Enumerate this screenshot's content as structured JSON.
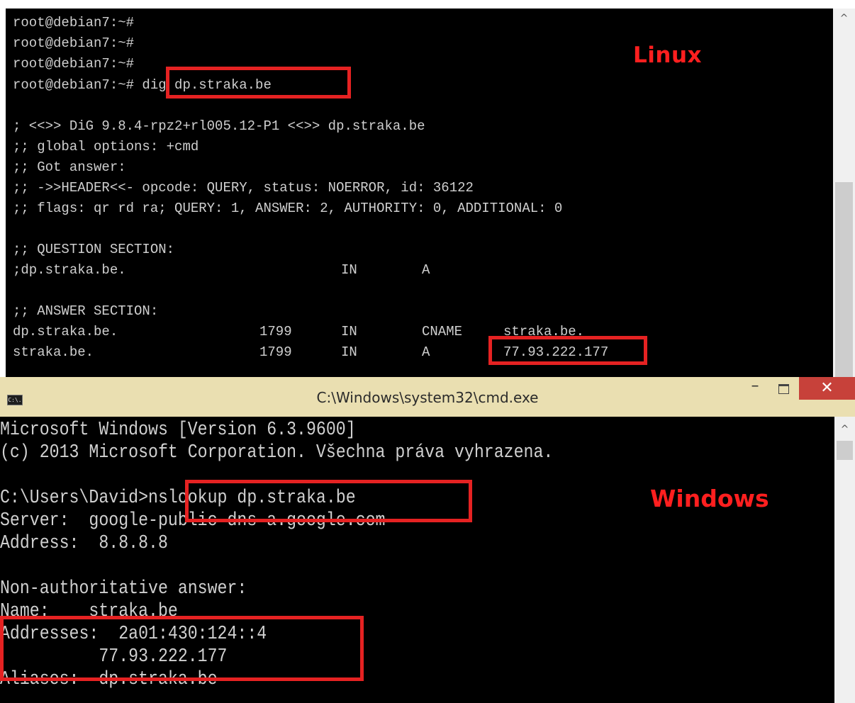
{
  "linux": {
    "label": "Linux",
    "lines": [
      {
        "text": "root@debian7:~#"
      },
      {
        "text": "root@debian7:~#"
      },
      {
        "text": "root@debian7:~#"
      },
      {
        "text": "root@debian7:~# dig dp.straka.be"
      },
      {
        "text": ""
      },
      {
        "text": "; <<>> DiG 9.8.4-rpz2+rl005.12-P1 <<>> dp.straka.be"
      },
      {
        "text": ";; global options: +cmd"
      },
      {
        "text": ";; Got answer:"
      },
      {
        "text": ";; ->>HEADER<<- opcode: QUERY, status: NOERROR, id: 36122"
      },
      {
        "text": ";; flags: qr rd ra; QUERY: 1, ANSWER: 2, AUTHORITY: 0, ADDITIONAL: 0"
      },
      {
        "text": ""
      },
      {
        "text": ";; QUESTION SECTION:"
      }
    ],
    "question": {
      "name": ";dp.straka.be.",
      "class": "IN",
      "type": "A"
    },
    "answer_header": ";; ANSWER SECTION:",
    "answers": [
      {
        "name": "dp.straka.be.",
        "ttl": "1799",
        "class": "IN",
        "type": "CNAME",
        "data": "straka.be."
      },
      {
        "name": "straka.be.",
        "ttl": "1799",
        "class": "IN",
        "type": "A",
        "data": "77.93.222.177"
      }
    ]
  },
  "windows": {
    "title": "C:\\Windows\\system32\\cmd.exe",
    "app_icon": "C:\\.",
    "minimize": "–",
    "close": "✕",
    "label": "Windows",
    "lines": [
      {
        "text": "Microsoft Windows [Version 6.3.9600]"
      },
      {
        "text": "(c) 2013 Microsoft Corporation. Všechna práva vyhrazena."
      },
      {
        "text": ""
      },
      {
        "text": "C:\\Users\\David>nslookup dp.straka.be"
      },
      {
        "text": "Server:  google-public-dns-a.google.com"
      },
      {
        "text": "Address:  8.8.8.8"
      },
      {
        "text": ""
      },
      {
        "text": "Non-authoritative answer:"
      },
      {
        "text": "Name:    straka.be"
      },
      {
        "text": "Addresses:  2a01:430:124::4"
      },
      {
        "text": "          77.93.222.177"
      },
      {
        "text": "Aliases:  dp.straka.be"
      }
    ]
  },
  "colors": {
    "highlight": "#e52222",
    "label": "#ff1f1f",
    "titlebar": "#eadfb1",
    "close_button": "#c7413a"
  }
}
